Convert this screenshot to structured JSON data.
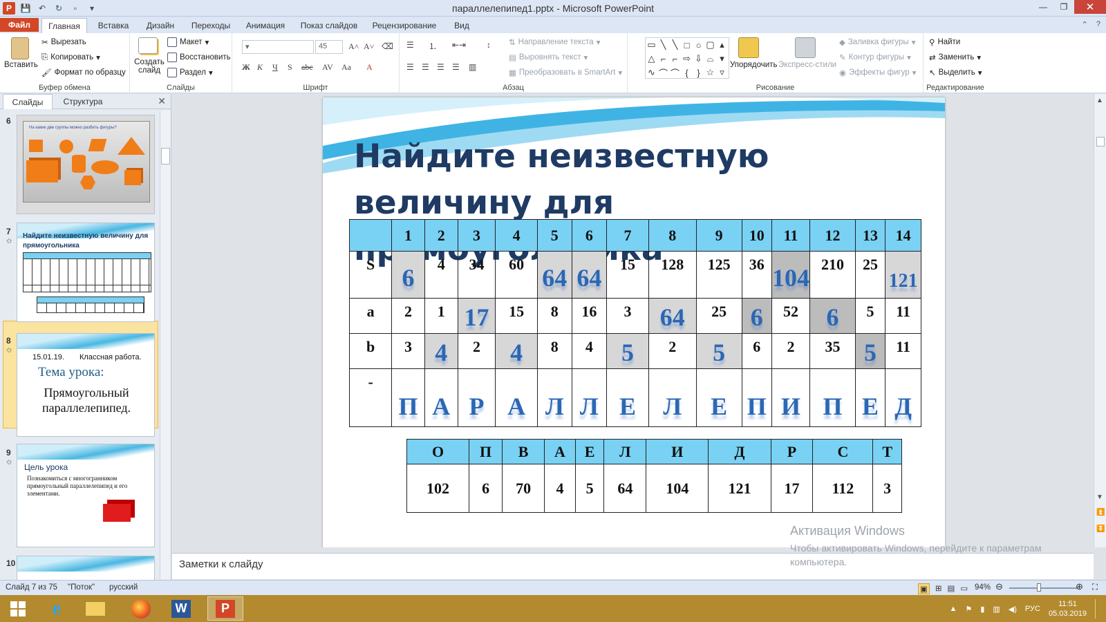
{
  "window": {
    "title": "параллелепипед1.pptx - Microsoft PowerPoint"
  },
  "tabs": [
    "Файл",
    "Главная",
    "Вставка",
    "Дизайн",
    "Переходы",
    "Анимация",
    "Показ слайдов",
    "Рецензирование",
    "Вид"
  ],
  "ribbon": {
    "clipboard": {
      "label": "Буфер обмена",
      "paste": "Вставить",
      "cut": "Вырезать",
      "copy": "Копировать",
      "format": "Формат по образцу"
    },
    "slides": {
      "label": "Слайды",
      "new_slide": "Создать слайд",
      "layout": "Макет",
      "reset": "Восстановить",
      "section": "Раздел"
    },
    "font": {
      "label": "Шрифт",
      "size": "45"
    },
    "paragraph": {
      "label": "Абзац",
      "text_direction": "Направление текста",
      "align_text": "Выровнять текст",
      "smartart": "Преобразовать в SmartArt"
    },
    "drawing": {
      "label": "Рисование",
      "arrange": "Упорядочить",
      "quick_styles": "Экспресс-стили",
      "fill": "Заливка фигуры",
      "outline": "Контур фигуры",
      "effects": "Эффекты фигур"
    },
    "editing": {
      "label": "Редактирование",
      "find": "Найти",
      "replace": "Заменить",
      "select": "Выделить"
    }
  },
  "panel": {
    "tab_slides": "Слайды",
    "tab_outline": "Структура",
    "thumbs": [
      {
        "num": "6",
        "text": "На какие две группы можно разбить фигуры?"
      },
      {
        "num": "7",
        "title": "Найдите неизвестную величину для прямоугольника"
      },
      {
        "num": "8",
        "date": "15.01.19.",
        "kind": "Классная работа.",
        "topic": "Тема урока:",
        "body": "Прямоугольный параллелепипед."
      },
      {
        "num": "9",
        "title": "Цель урока",
        "body": "Познакомиться с многогранником прямоугольный параллелепипед и его элементами."
      },
      {
        "num": "10"
      }
    ]
  },
  "slide": {
    "title": "Найдите неизвестную величину для прямоугольника",
    "header": [
      "",
      "1",
      "2",
      "3",
      "4",
      "5",
      "6",
      "7",
      "8",
      "9",
      "10",
      "11",
      "12",
      "13",
      "14"
    ],
    "rows": [
      {
        "label": "S",
        "cells": [
          "6",
          "4",
          "34",
          "60",
          "64",
          "64",
          "15",
          "128",
          "125",
          "36",
          "104",
          "210",
          "25",
          "121"
        ]
      },
      {
        "label": "a",
        "cells": [
          "2",
          "1",
          "17",
          "15",
          "8",
          "16",
          "3",
          "64",
          "25",
          "6",
          "52",
          "6",
          "5",
          "11"
        ]
      },
      {
        "label": "b",
        "cells": [
          "3",
          "4",
          "2",
          "4",
          "8",
          "4",
          "5",
          "2",
          "5",
          "6",
          "2",
          "35",
          "5",
          "11"
        ]
      },
      {
        "label": "-",
        "cells": [
          "П",
          "А",
          "Р",
          "А",
          "Л",
          "Л",
          "Е",
          "Л",
          "Е",
          "П",
          "И",
          "П",
          "Е",
          "Д"
        ]
      }
    ],
    "key_letters": [
      "О",
      "П",
      "В",
      "А",
      "Е",
      "Л",
      "И",
      "Д",
      "Р",
      "С",
      "Т"
    ],
    "key_values": [
      "102",
      "6",
      "70",
      "4",
      "5",
      "64",
      "104",
      "121",
      "17",
      "112",
      "3"
    ]
  },
  "notes": {
    "placeholder": "Заметки к слайду"
  },
  "activation": {
    "line1": "Активация Windows",
    "line2": "Чтобы активировать Windows, перейдите к параметрам компьютера."
  },
  "status": {
    "slide_info": "Слайд 7 из 75",
    "theme": "\"Поток\"",
    "lang": "русский",
    "zoom": "94%"
  },
  "tray": {
    "lang": "РУС",
    "time": "11:51",
    "date": "05.03.2019"
  },
  "colors": {
    "accent_file": "#d24726",
    "header_cell": "#79d1f4",
    "slide_title": "#1f3b64",
    "answer_blue": "#2b67b5"
  }
}
